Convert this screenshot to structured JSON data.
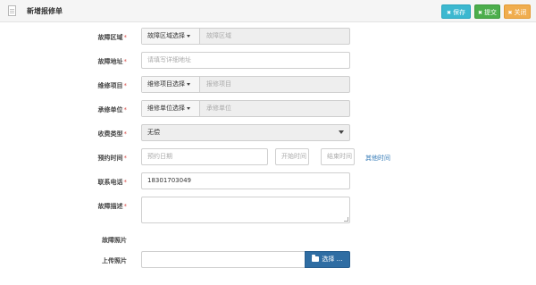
{
  "header": {
    "title": "新增报修单",
    "buttons": {
      "save": "保存",
      "submit": "提交",
      "close": "关闭"
    },
    "colors": {
      "save": "#3cb8d0",
      "submit": "#4cae4c",
      "close": "#f0ad4e"
    }
  },
  "form": {
    "fault_area": {
      "label": "故障区域",
      "select_label": "故障区域选择",
      "placeholder": "故障区域"
    },
    "fault_address": {
      "label": "故障地址",
      "placeholder": "请填写详细地址"
    },
    "repair_item": {
      "label": "维修项目",
      "select_label": "维修项目选择",
      "placeholder": "报修项目"
    },
    "contractor": {
      "label": "承修单位",
      "select_label": "维修单位选择",
      "placeholder": "承修单位"
    },
    "fee_type": {
      "label": "收费类型",
      "value": "无偿"
    },
    "appointment": {
      "label": "预约时间",
      "date_placeholder": "预约日期",
      "start_placeholder": "开始时间",
      "end_placeholder": "结束时间",
      "other_time_link": "其他时间"
    },
    "phone": {
      "label": "联系电话",
      "value": "18301703049"
    },
    "description": {
      "label": "故障描述"
    },
    "photos": {
      "label": "故障照片"
    },
    "upload": {
      "label": "上传照片",
      "button": "选择 …"
    },
    "required_mark": "*"
  }
}
